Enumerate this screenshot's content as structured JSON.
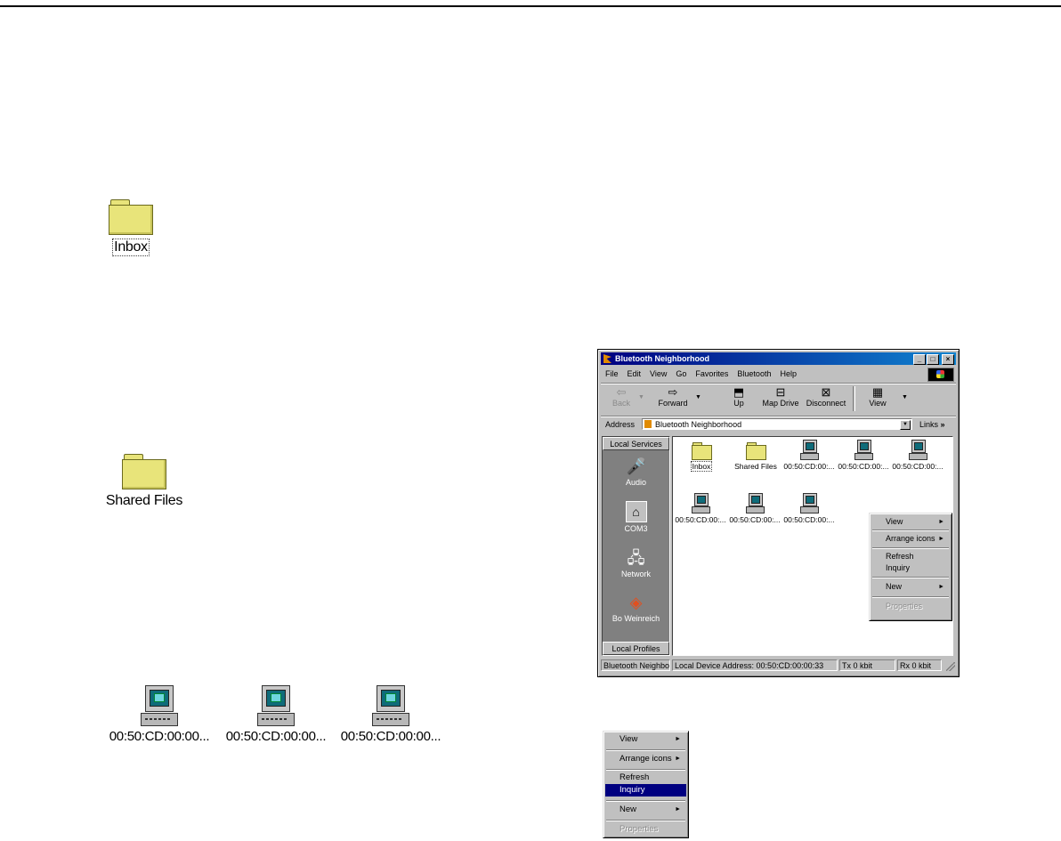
{
  "big_icons": {
    "inbox": {
      "label": "Inbox"
    },
    "shared_files": {
      "label": "Shared Files"
    },
    "devices": [
      {
        "label": "00:50:CD:00:00..."
      },
      {
        "label": "00:50:CD:00:00..."
      },
      {
        "label": "00:50:CD:00:00..."
      }
    ]
  },
  "window": {
    "title": "Bluetooth Neighborhood",
    "controls": {
      "minimize": "_",
      "maximize": "□",
      "close": "×"
    },
    "menu": [
      "File",
      "Edit",
      "View",
      "Go",
      "Favorites",
      "Bluetooth",
      "Help"
    ],
    "toolbar": {
      "back": "Back",
      "forward": "Forward",
      "up": "Up",
      "map_drive": "Map Drive",
      "disconnect": "Disconnect",
      "view": "View"
    },
    "address": {
      "label": "Address",
      "value": "Bluetooth Neighborhood",
      "links": "Links",
      "links_chevron": "»"
    },
    "left_pane": {
      "header": "Local Services",
      "items": [
        "Audio",
        "COM3",
        "Network",
        "Bo Weinreich"
      ],
      "footer": "Local Profiles"
    },
    "items": [
      {
        "label": "Inbox",
        "type": "folder"
      },
      {
        "label": "Shared Files",
        "type": "folder"
      },
      {
        "label": "00:50:CD:00:...",
        "type": "device"
      },
      {
        "label": "00:50:CD:00:...",
        "type": "device"
      },
      {
        "label": "00:50:CD:00:...",
        "type": "device"
      },
      {
        "label": "00:50:CD:00:...",
        "type": "device"
      },
      {
        "label": "00:50:CD:00:...",
        "type": "device"
      },
      {
        "label": "00:50:CD:00:...",
        "type": "device"
      }
    ],
    "status": {
      "pane1": "Bluetooth Neighbor",
      "pane2": "Local Device Address: 00:50:CD:00:00:33",
      "pane3": "Tx    0 kbit",
      "pane4": "Rx    0 kbit"
    }
  },
  "context_menu": {
    "view": "View",
    "arrange": "Arrange icons",
    "refresh": "Refresh",
    "inquiry": "Inquiry",
    "new": "New",
    "properties": "Properties",
    "submenu_arrow": "►"
  },
  "colors": {
    "title_gradient_start": "#000080",
    "title_gradient_end": "#1084d0",
    "highlight": "#000080",
    "face": "#c0c0c0",
    "folder": "#e8e47a"
  }
}
